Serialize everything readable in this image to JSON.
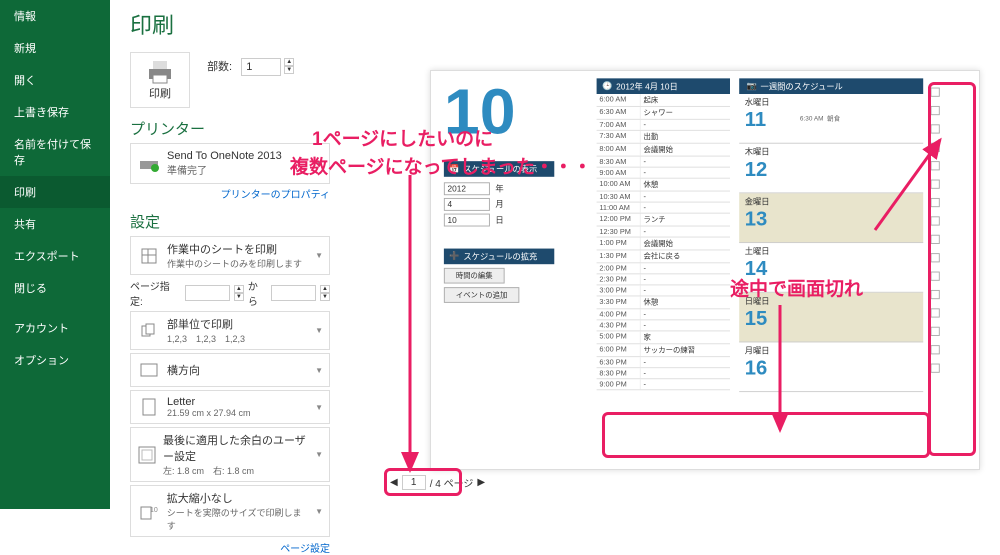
{
  "sidebar": {
    "items": [
      {
        "label": "情報"
      },
      {
        "label": "新規"
      },
      {
        "label": "開く"
      },
      {
        "label": "上書き保存"
      },
      {
        "label": "名前を付けて保存"
      },
      {
        "label": "印刷"
      },
      {
        "label": "共有"
      },
      {
        "label": "エクスポート"
      },
      {
        "label": "閉じる"
      },
      {
        "label": "アカウント"
      },
      {
        "label": "オプション"
      }
    ],
    "activeIndex": 5
  },
  "page": {
    "title": "印刷",
    "print_btn": "印刷",
    "copies_label": "部数:",
    "copies_value": "1"
  },
  "printer": {
    "section": "プリンター",
    "name": "Send To OneNote 2013",
    "status": "準備完了",
    "properties_link": "プリンターのプロパティ"
  },
  "settings": {
    "section": "設定",
    "print_active": {
      "t1": "作業中のシートを印刷",
      "t2": "作業中のシートのみを印刷します"
    },
    "page_range": {
      "lbl": "ページ指定:",
      "from": "",
      "to_lbl": "から",
      "to": ""
    },
    "collate": {
      "t1": "部単位で印刷",
      "t2": "1,2,3　1,2,3　1,2,3"
    },
    "orient": {
      "t1": "横方向",
      "t2": ""
    },
    "paper": {
      "t1": "Letter",
      "t2": "21.59 cm x 27.94 cm"
    },
    "margin": {
      "t1": "最後に適用した余白のユーザー設定",
      "t2": "左: 1.8 cm　右: 1.8 cm"
    },
    "scale": {
      "t1": "拡大縮小なし",
      "t2": "シートを実際のサイズで印刷します"
    },
    "page_setup_link": "ページ設定"
  },
  "preview": {
    "big_date": "10",
    "sch_header": "スケジュールの表示",
    "year": "2012",
    "year_u": "年",
    "month": "4",
    "month_u": "月",
    "day": "10",
    "day_u": "日",
    "sch_header2": "スケジュールの拡充",
    "btn_edit": "時間の編集",
    "btn_ev": "イベントの追加",
    "date_title": "2012年 4月 10日",
    "schedule": [
      {
        "t": "6:00 AM",
        "v": "起床"
      },
      {
        "t": "6:30 AM",
        "v": "シャワー"
      },
      {
        "t": "7:00 AM",
        "v": "-"
      },
      {
        "t": "7:30 AM",
        "v": "出勤"
      },
      {
        "t": "8:00 AM",
        "v": "会議開始"
      },
      {
        "t": "8:30 AM",
        "v": "-"
      },
      {
        "t": "9:00 AM",
        "v": "-"
      },
      {
        "t": "10:00 AM",
        "v": "休憩"
      },
      {
        "t": "10:30 AM",
        "v": "-"
      },
      {
        "t": "11:00 AM",
        "v": "-"
      },
      {
        "t": "12:00 PM",
        "v": "ランチ"
      },
      {
        "t": "12:30 PM",
        "v": "-"
      },
      {
        "t": "1:00 PM",
        "v": "会議開始"
      },
      {
        "t": "1:30 PM",
        "v": "会社に戻る"
      },
      {
        "t": "2:00 PM",
        "v": "-"
      },
      {
        "t": "2:30 PM",
        "v": "-"
      },
      {
        "t": "3:00 PM",
        "v": "-"
      },
      {
        "t": "3:30 PM",
        "v": "休憩"
      },
      {
        "t": "4:00 PM",
        "v": "-"
      },
      {
        "t": "4:30 PM",
        "v": "-"
      },
      {
        "t": "5:00 PM",
        "v": "家"
      },
      {
        "t": "6:00 PM",
        "v": "サッカーの練習"
      },
      {
        "t": "6:30 PM",
        "v": "-"
      },
      {
        "t": "8:30 PM",
        "v": "-"
      },
      {
        "t": "9:00 PM",
        "v": "-"
      }
    ],
    "week_header": "一週間のスケジュール",
    "first_day_note_t": "6:30 AM",
    "first_day_note_v": "朝食",
    "week": [
      {
        "dw": "水曜日",
        "dn": "11",
        "shade": false
      },
      {
        "dw": "木曜日",
        "dn": "12",
        "shade": false
      },
      {
        "dw": "金曜日",
        "dn": "13",
        "shade": true
      },
      {
        "dw": "土曜日",
        "dn": "14",
        "shade": false
      },
      {
        "dw": "日曜日",
        "dn": "15",
        "shade": true
      },
      {
        "dw": "月曜日",
        "dn": "16",
        "shade": false
      }
    ]
  },
  "pager": {
    "current": "1",
    "total": "4 ページ",
    "prev": "◀",
    "next": "▶"
  },
  "annotations": {
    "a1": "1ページにしたいのに",
    "a2": "複数ページになってしまった・・・",
    "a3": "途中で画面切れ"
  }
}
